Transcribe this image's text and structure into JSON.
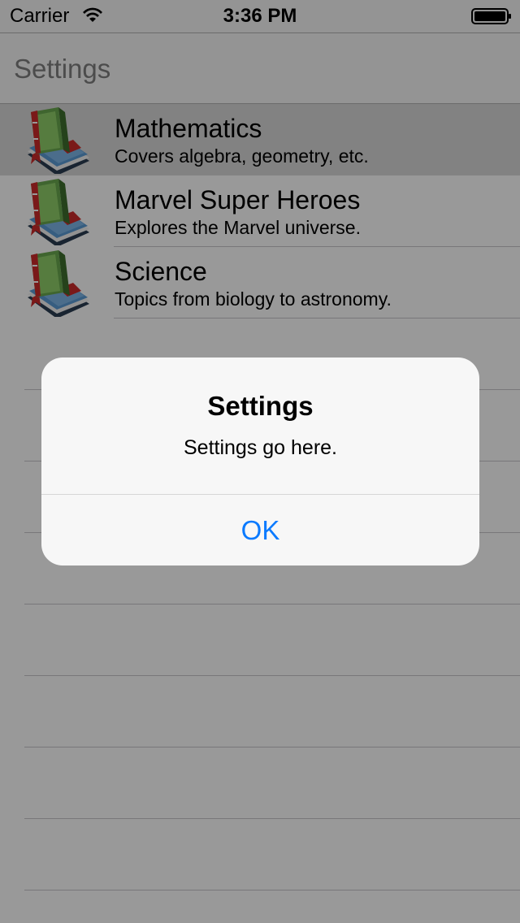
{
  "status_bar": {
    "carrier": "Carrier",
    "time": "3:36 PM",
    "wifi_icon": "wifi-icon",
    "battery_icon": "battery-icon"
  },
  "nav_bar": {
    "title": "Settings"
  },
  "table": {
    "rows": [
      {
        "title": "Mathematics",
        "subtitle": "Covers algebra, geometry, etc.",
        "icon": "book-stack-icon",
        "selected": true
      },
      {
        "title": "Marvel Super Heroes",
        "subtitle": "Explores the Marvel universe.",
        "icon": "book-stack-icon",
        "selected": false
      },
      {
        "title": "Science",
        "subtitle": "Topics from biology to astronomy.",
        "icon": "book-stack-icon",
        "selected": false
      }
    ]
  },
  "alert": {
    "title": "Settings",
    "message": "Settings go here.",
    "ok_label": "OK"
  },
  "colors": {
    "accent": "#0a7aff",
    "selected_row": "#d9d9d9",
    "nav_title": "#7f7f7f",
    "separator": "#c8c7cc"
  }
}
